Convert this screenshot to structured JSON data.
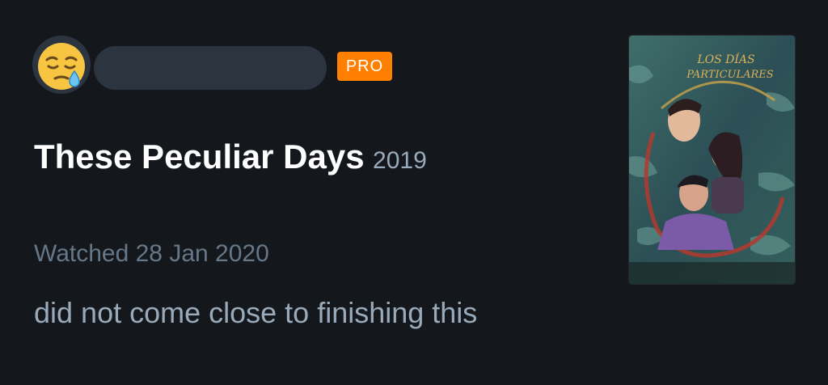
{
  "user": {
    "avatar_icon": "sad-sleepy-face-icon",
    "badge": "PRO",
    "badge_color": "#ff8000"
  },
  "film": {
    "title": "These Peculiar Days",
    "year": "2019",
    "poster_title_line1": "LOS DÍAS",
    "poster_title_line2": "PARTICULARES"
  },
  "entry": {
    "watched": "Watched 28 Jan 2020",
    "review": "did not come close to finishing this"
  },
  "colors": {
    "background": "#14181c",
    "title": "#ffffff",
    "secondary_text": "#9ab",
    "muted_text": "#678"
  }
}
